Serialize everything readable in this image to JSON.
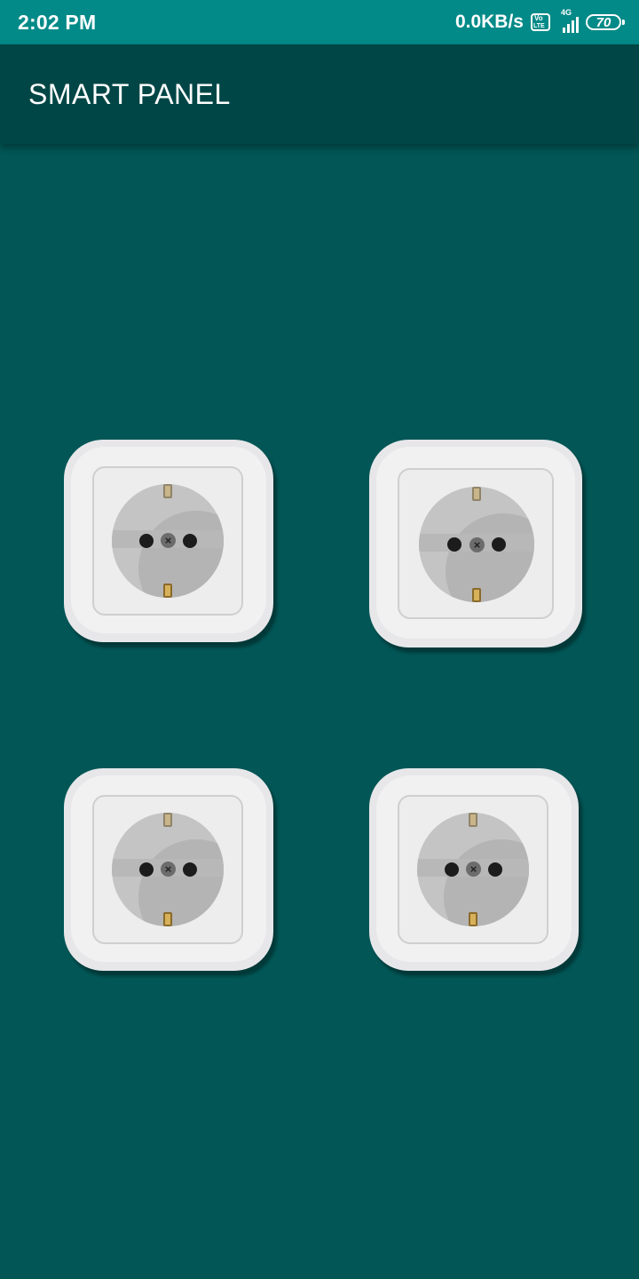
{
  "status_bar": {
    "time": "2:02 PM",
    "network_speed": "0.0KB/s",
    "network_type": "4G",
    "battery_level": "70"
  },
  "app_bar": {
    "title": "SMART PANEL"
  },
  "sockets": [
    {
      "name": "socket-1"
    },
    {
      "name": "socket-2"
    },
    {
      "name": "socket-3"
    },
    {
      "name": "socket-4"
    }
  ],
  "colors": {
    "status_bar": "#028a88",
    "app_bar": "#004646",
    "background": "#025656"
  }
}
